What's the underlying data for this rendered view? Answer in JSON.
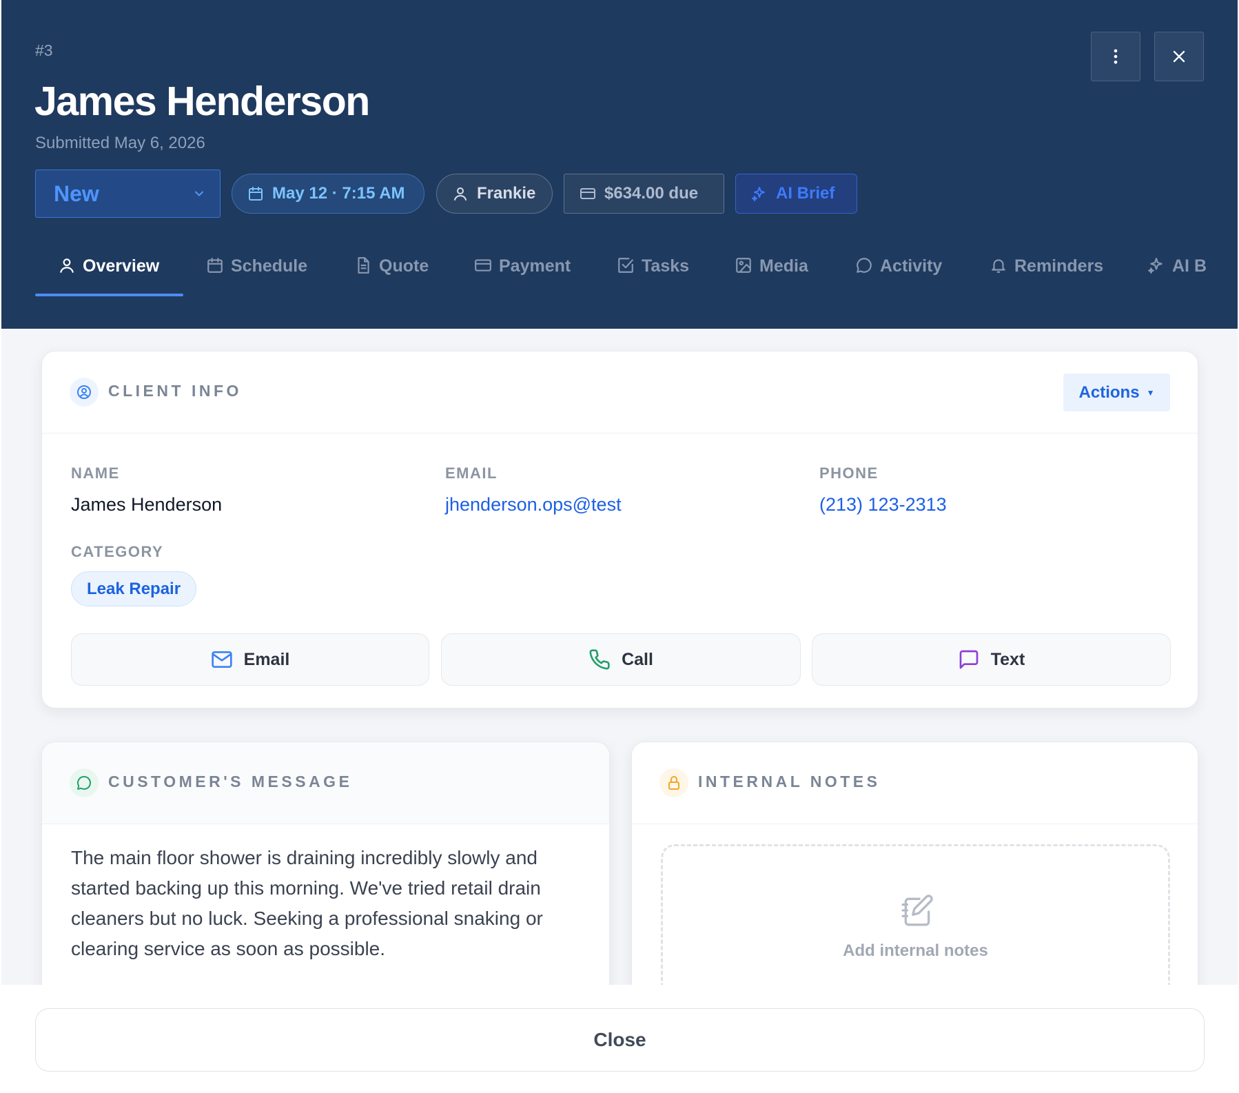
{
  "header": {
    "job_number": "#3",
    "title": "James Henderson",
    "submitted": "Submitted May 6, 2026",
    "status": {
      "selected": "New"
    },
    "schedule_pill": "May 12 · 7:15 AM",
    "technician_pill": "Frankie",
    "due_pill": "$634.00 due",
    "ai_pill": "AI Brief",
    "menu_icon": "more-vertical-icon",
    "close_icon": "close-icon"
  },
  "tabs": [
    {
      "label": "Overview",
      "icon": "user-icon",
      "active": true
    },
    {
      "label": "Schedule",
      "icon": "calendar-icon"
    },
    {
      "label": "Quote",
      "icon": "document-icon"
    },
    {
      "label": "Payment",
      "icon": "credit-card-icon"
    },
    {
      "label": "Tasks",
      "icon": "checkbox-icon"
    },
    {
      "label": "Media",
      "icon": "image-icon"
    },
    {
      "label": "Activity",
      "icon": "chat-bubble-icon"
    },
    {
      "label": "Reminders",
      "icon": "bell-icon"
    },
    {
      "label": "AI B",
      "icon": "sparkles-icon"
    }
  ],
  "client_info": {
    "title": "CLIENT INFO",
    "actions_label": "Actions",
    "name_label": "NAME",
    "name_value": "James Henderson",
    "email_label": "EMAIL",
    "email_value": "jhenderson.ops@test",
    "phone_label": "PHONE",
    "phone_value": "(213) 123-2313",
    "category_label": "CATEGORY",
    "category_value": "Leak Repair",
    "buttons": {
      "email": "Email",
      "call": "Call",
      "text": "Text"
    }
  },
  "customer_message": {
    "title": "CUSTOMER'S MESSAGE",
    "body": "The main floor shower is draining incredibly slowly and started backing up this morning. We've tried retail drain cleaners but no luck. Seeking a professional snaking or clearing service as soon as possible."
  },
  "internal_notes": {
    "title": "INTERNAL NOTES",
    "placeholder": "Add internal notes"
  },
  "footer": {
    "close_label": "Close"
  },
  "colors": {
    "header_bg": "#1f3a5f",
    "accent": "#1c5fe6",
    "tab_active_underline": "#4c8cf5",
    "call_green": "#22a06b",
    "text_purple": "#8b3fd9",
    "lock_amber": "#f5a623"
  }
}
